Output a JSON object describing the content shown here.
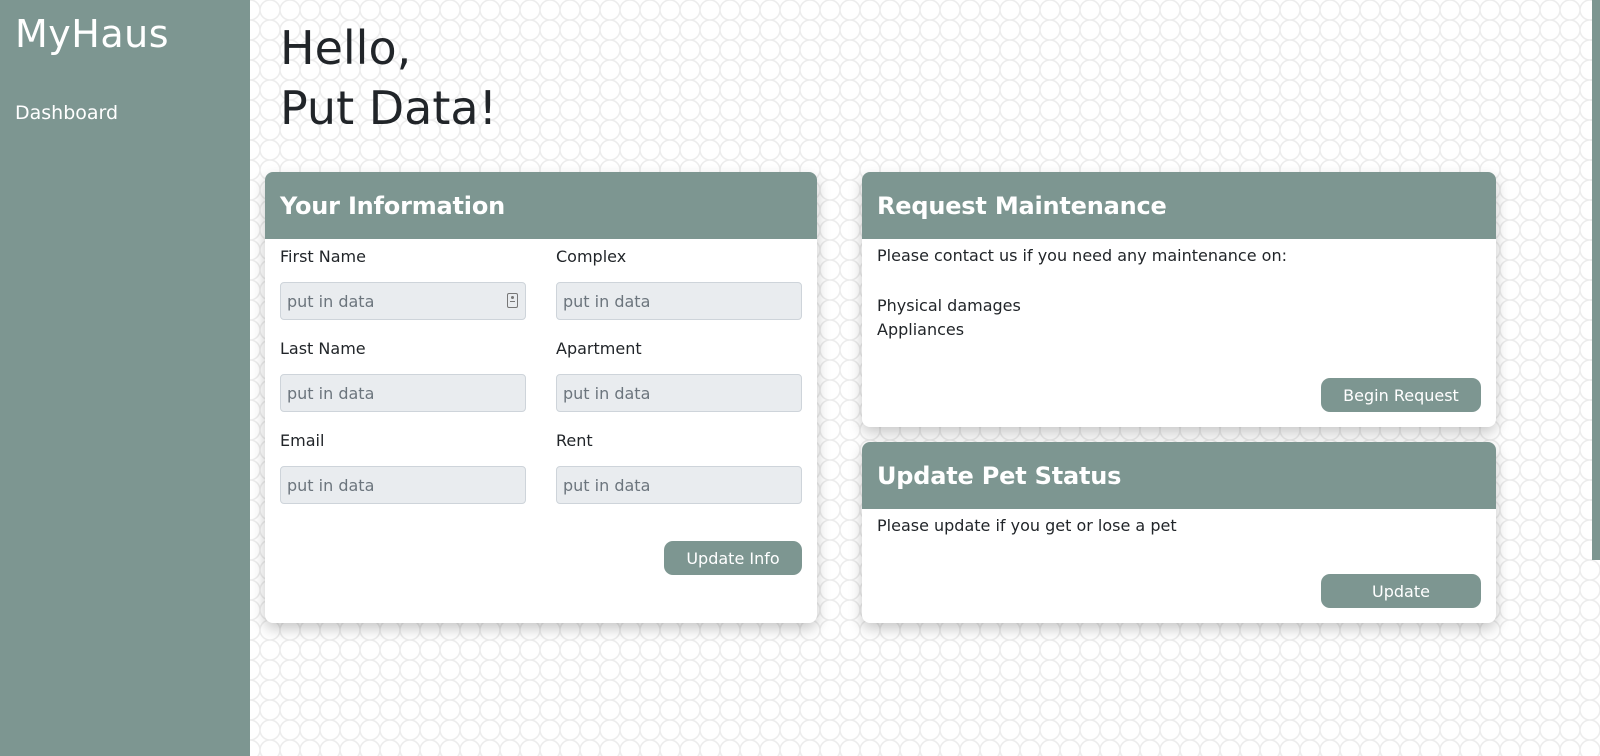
{
  "app": {
    "title": "MyHaus"
  },
  "sidebar": {
    "items": [
      {
        "label": "Dashboard"
      }
    ]
  },
  "greeting": {
    "line1": "Hello,",
    "line2": "Put Data!"
  },
  "info_card": {
    "title": "Your Information",
    "fields": {
      "first_name": {
        "label": "First Name",
        "value": "",
        "placeholder": "put in data"
      },
      "complex": {
        "label": "Complex",
        "value": "",
        "placeholder": "put in data"
      },
      "last_name": {
        "label": "Last Name",
        "value": "",
        "placeholder": "put in data"
      },
      "apartment": {
        "label": "Apartment",
        "value": "",
        "placeholder": "put in data"
      },
      "email": {
        "label": "Email",
        "value": "",
        "placeholder": "put in data"
      },
      "rent": {
        "label": "Rent",
        "value": "",
        "placeholder": "put in data"
      }
    },
    "button_label": "Update Info"
  },
  "maintenance_card": {
    "title": "Request Maintenance",
    "intro": "Please contact us if you need any maintenance on:",
    "items": [
      "Physical damages",
      "Appliances"
    ],
    "button_label": "Begin Request"
  },
  "pet_card": {
    "title": "Update Pet Status",
    "text": "Please update if you get or lose a pet",
    "button_label": "Update"
  },
  "colors": {
    "accent": "#7d9691",
    "input_bg": "#e9ecef",
    "text": "#212529"
  },
  "icons": {
    "first_name_field": "contact-card-icon"
  }
}
